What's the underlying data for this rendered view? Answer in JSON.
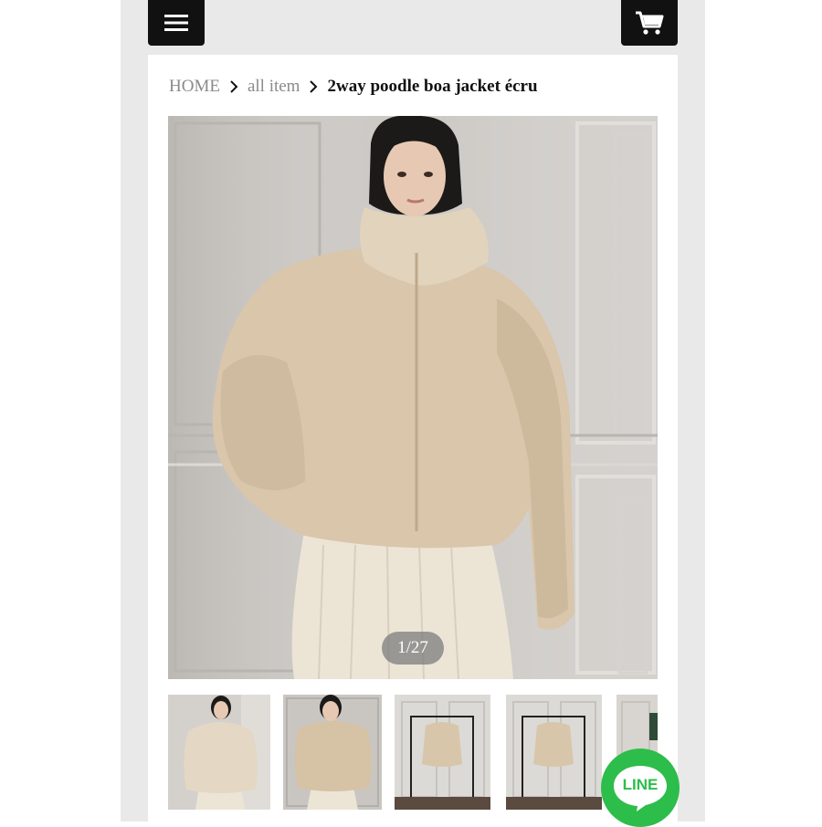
{
  "header": {
    "menu_icon": "hamburger-menu-icon",
    "cart_icon": "shopping-cart-icon"
  },
  "breadcrumb": {
    "home": "HOME",
    "category": "all item",
    "current": "2way poodle boa jacket écru",
    "separator_icon": "chevron-right-icon"
  },
  "gallery": {
    "counter": "1/27",
    "thumbnail_count_visible": 5
  },
  "chat_button": {
    "label": "LINE",
    "color": "#2dbd4a"
  },
  "colors": {
    "header_bg": "#111111",
    "frame_bg": "#e9e9e9",
    "jacket": "#d9c6ab"
  }
}
